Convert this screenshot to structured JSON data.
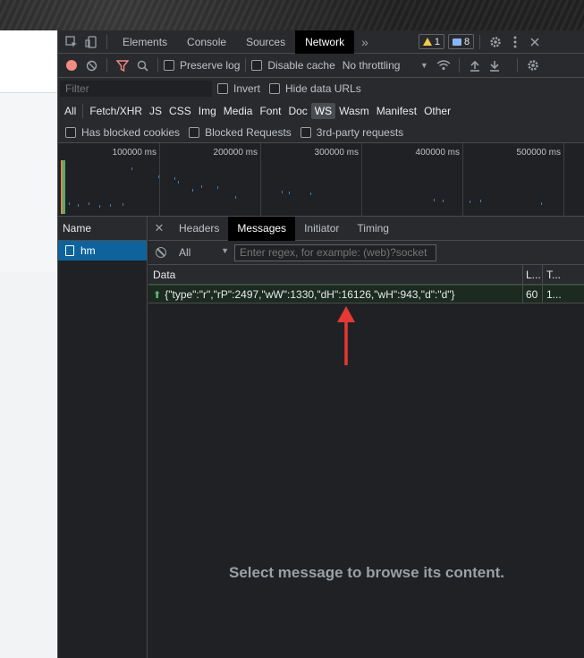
{
  "tabbar": {
    "tabs": [
      "Elements",
      "Console",
      "Sources",
      "Network"
    ],
    "active_tab": "Network",
    "more": "»",
    "warnings": "1",
    "messages": "8"
  },
  "toolbar": {
    "preserve_log": "Preserve log",
    "disable_cache": "Disable cache",
    "throttling": "No throttling"
  },
  "filterbar": {
    "placeholder": "Filter",
    "invert": "Invert",
    "hide_data_urls": "Hide data URLs"
  },
  "types": [
    "All",
    "Fetch/XHR",
    "JS",
    "CSS",
    "Img",
    "Media",
    "Font",
    "Doc",
    "WS",
    "Wasm",
    "Manifest",
    "Other"
  ],
  "active_type": "WS",
  "blockbar": {
    "blocked_cookies": "Has blocked cookies",
    "blocked_requests": "Blocked Requests",
    "third_party": "3rd-party requests"
  },
  "overview": {
    "labels": [
      "100000 ms",
      "200000 ms",
      "300000 ms",
      "400000 ms",
      "500000 ms"
    ]
  },
  "requests": {
    "header": "Name",
    "items": [
      "hm"
    ]
  },
  "detail": {
    "tabs": [
      "Headers",
      "Messages",
      "Initiator",
      "Timing"
    ],
    "active_tab": "Messages",
    "filter_select": "All",
    "regex_placeholder": "Enter regex, for example: (web)?socket",
    "columns": [
      "Data",
      "L...",
      "T..."
    ],
    "messages": [
      {
        "data": "{\"type\":\"r\",\"rP\":2497,\"wW\":1330,\"dH\":16126,\"wH\":943,\"d\":\"d\"}",
        "length": "60",
        "time": "1..."
      }
    ],
    "empty_text": "Select message to browse its content."
  },
  "colors": {
    "annotation_arrow": "#e53935",
    "selected_row": "#0e639c",
    "sent_arrow": "#5bb974"
  }
}
